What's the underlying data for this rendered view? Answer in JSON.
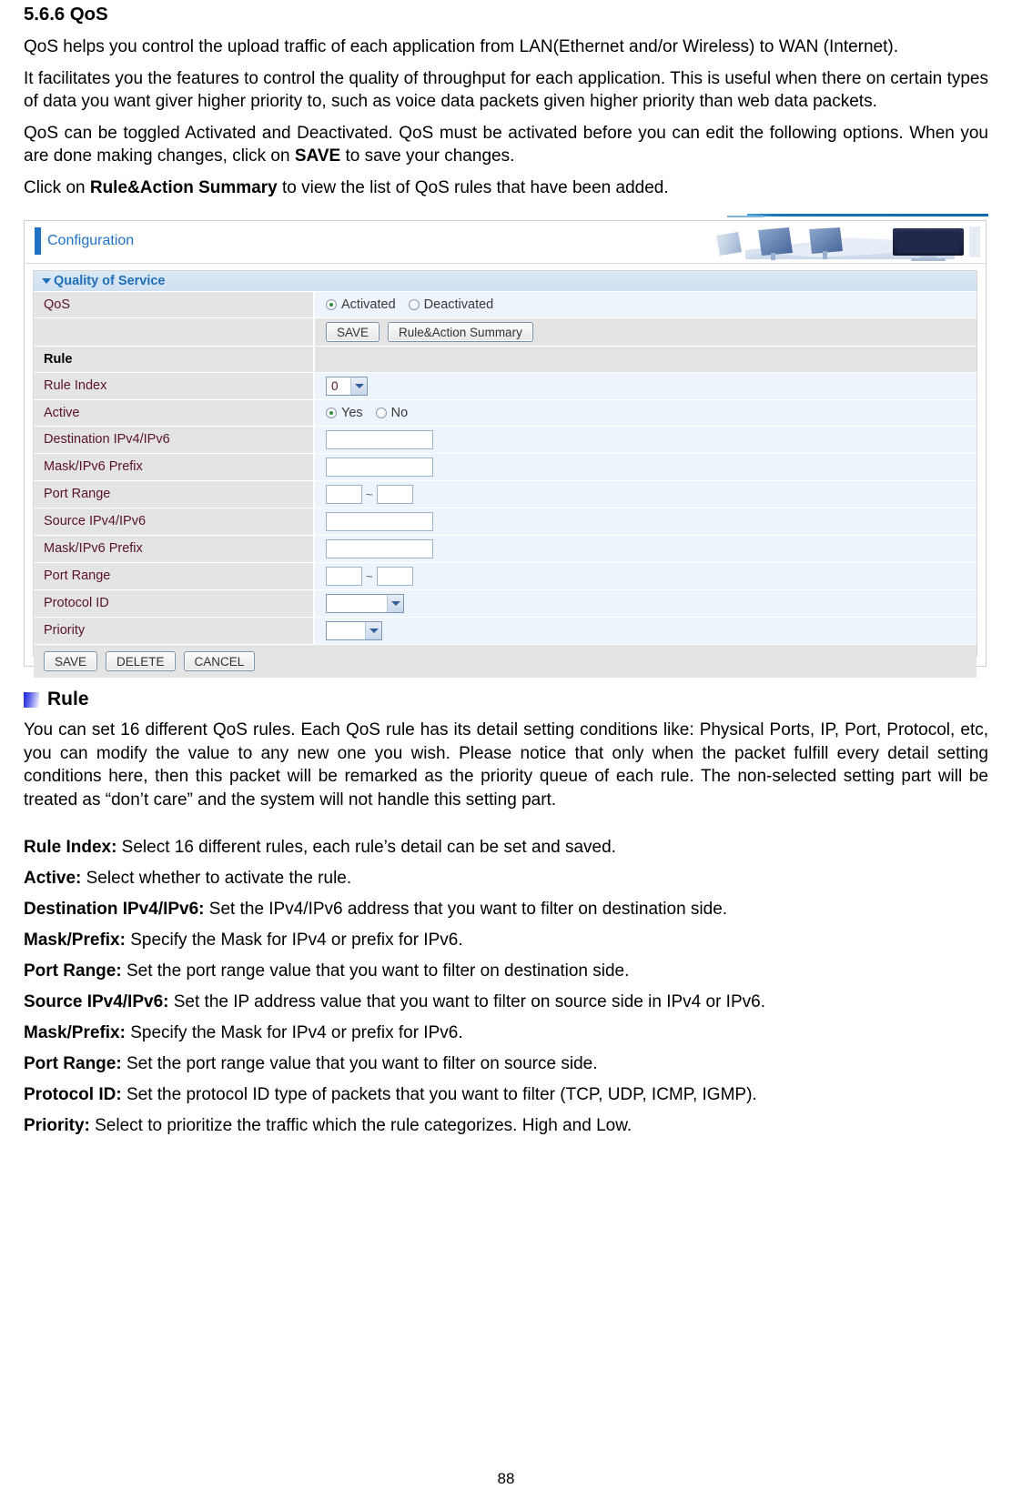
{
  "document": {
    "heading": "5.6.6 QoS",
    "paragraphs": [
      "QoS helps you control the upload traffic of each application from LAN(Ethernet and/or Wireless) to WAN (Internet).",
      "It facilitates you the features to control the quality of throughput for each application. This is useful when there on certain types of data you want giver higher priority to, such as voice data packets given higher priority than web data packets."
    ],
    "para3_pre": "QoS can be toggled Activated and Deactivated. QoS must be activated before you can edit the following options. When you are done making changes, click on ",
    "para3_bold": "SAVE",
    "para3_post": " to save your changes.",
    "para4_pre": "Click on ",
    "para4_bold": "Rule&Action Summary",
    "para4_post": " to view the list of QoS rules that have been added.",
    "rule_heading": "Rule",
    "rule_paragraph": "You can set 16 different QoS rules. Each QoS rule has its detail setting conditions like: Physical Ports, IP, Port, Protocol, etc, you can modify the value to any new one you wish. Please notice that only when the packet fulfill every detail setting conditions here, then this packet will be remarked as the priority queue of each rule. The non-selected setting part will be treated as “don’t care” and the system will not handle this setting part.",
    "definitions": [
      {
        "term": "Rule Index:",
        "desc": " Select 16 different rules, each rule’s detail can be set and saved."
      },
      {
        "term": "Active:",
        "desc": " Select whether to activate the rule."
      },
      {
        "term": "Destination IPv4/IPv6:",
        "desc": " Set the IPv4/IPv6 address that you want to filter on destination side."
      },
      {
        "term": "Mask/Prefix:",
        "desc": " Specify the Mask for IPv4 or prefix for IPv6."
      },
      {
        "term": "Port Range:",
        "desc": " Set the port range value that you want to filter on destination side."
      },
      {
        "term": "Source IPv4/IPv6:",
        "desc": " Set the IP address value that you want to filter on source side in IPv4 or IPv6."
      },
      {
        "term": "Mask/Prefix:",
        "desc": " Specify the Mask for IPv4 or prefix for IPv6."
      },
      {
        "term": "Port Range:",
        "desc": " Set the port range value that you want to filter on source side."
      },
      {
        "term": "Protocol ID:",
        "desc": " Set the protocol ID type of packets that you want to filter (TCP, UDP, ICMP, IGMP)."
      },
      {
        "term": "Priority:",
        "desc": " Select to prioritize the traffic which the rule categorizes. High and Low."
      }
    ],
    "page_number": "88"
  },
  "screenshot": {
    "header": {
      "title": "Configuration",
      "art_alt": "office-desk-illustration"
    },
    "panel": {
      "title": "Quality of Service",
      "qos_row": {
        "label": "QoS",
        "options": [
          {
            "label": "Activated",
            "selected": true
          },
          {
            "label": "Deactivated",
            "selected": false
          }
        ]
      },
      "action_row": {
        "save_label": "SAVE",
        "summary_label": "Rule&Action Summary"
      },
      "rule_section_label": "Rule",
      "rows": [
        {
          "label": "Rule Index",
          "type": "select",
          "value": "0",
          "width": "s-index"
        },
        {
          "label": "Active",
          "type": "radio",
          "options": [
            {
              "label": "Yes",
              "selected": true
            },
            {
              "label": "No",
              "selected": false
            }
          ]
        },
        {
          "label": "Destination IPv4/IPv6",
          "type": "text",
          "value": ""
        },
        {
          "label": "Mask/IPv6 Prefix",
          "type": "text",
          "value": ""
        },
        {
          "label": "Port Range",
          "type": "range",
          "from": "",
          "to": "",
          "separator": "~"
        },
        {
          "label": "Source IPv4/IPv6",
          "type": "text",
          "value": ""
        },
        {
          "label": "Mask/IPv6 Prefix",
          "type": "text",
          "value": ""
        },
        {
          "label": "Port Range",
          "type": "range",
          "from": "",
          "to": "",
          "separator": "~"
        },
        {
          "label": "Protocol ID",
          "type": "select",
          "value": "",
          "width": "s-proto"
        },
        {
          "label": "Priority",
          "type": "select",
          "value": "",
          "width": "s-prio"
        }
      ],
      "footer_buttons": [
        {
          "label": "SAVE"
        },
        {
          "label": "DELETE"
        },
        {
          "label": "CANCEL"
        }
      ]
    },
    "colors": {
      "accent_blue": "#1f72c4",
      "panel_title_blue": "#1f6fb8",
      "label_cell_bg": "#e4e4e4",
      "value_cell_bg": "#eef4fb",
      "label_text": "#5a1130",
      "radio_selected": "#2f8f3a"
    }
  }
}
